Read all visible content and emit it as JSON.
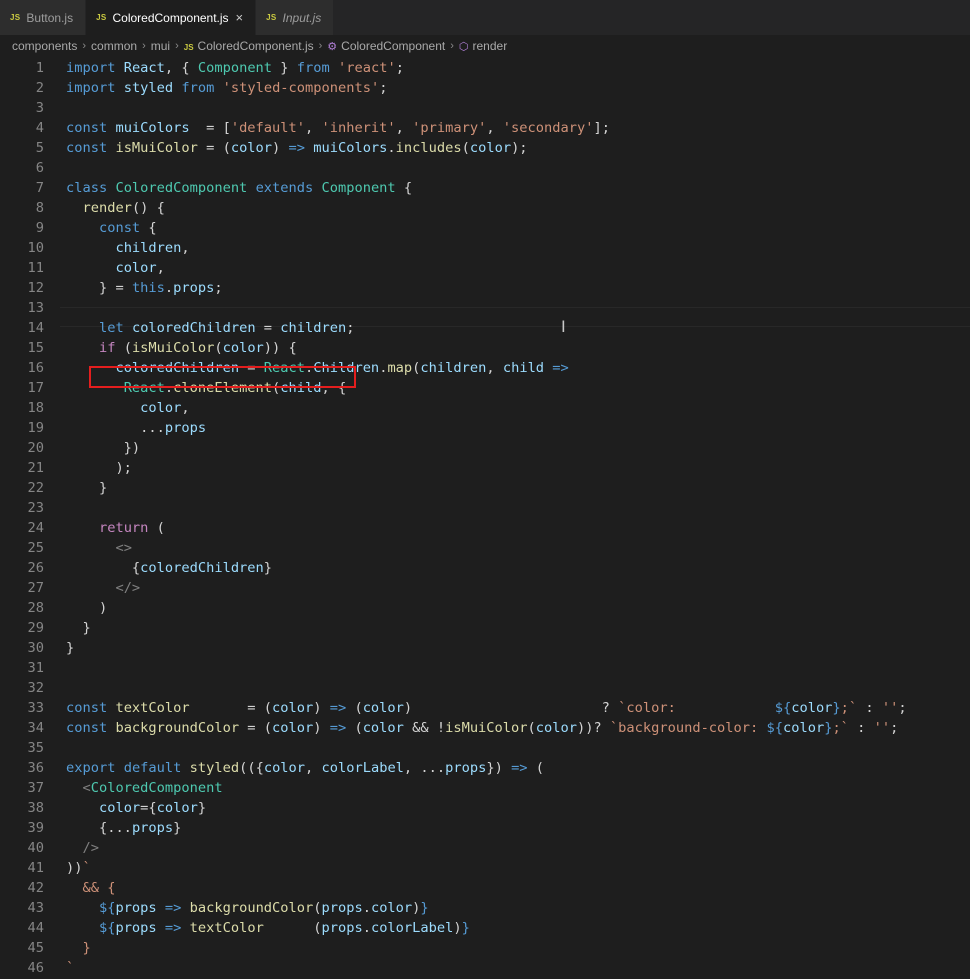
{
  "tabs": [
    {
      "icon": "JS",
      "label": "Button.js"
    },
    {
      "icon": "JS",
      "label": "ColoredComponent.js",
      "close": "×"
    },
    {
      "icon": "JS",
      "label": "Input.js"
    }
  ],
  "breadcrumbs": [
    "components",
    "common",
    "mui",
    "ColoredComponent.js",
    "ColoredComponent",
    "render"
  ],
  "breadcrumb_separator": "›",
  "cursor_glyph": "I",
  "colors": {
    "keyword": "#569cd6",
    "control": "#c586c0",
    "string": "#ce9178",
    "variable": "#9cdcfe",
    "function": "#dcdcaa",
    "class": "#4ec9b0",
    "highlight_box": "#e41e1e"
  },
  "icons": {
    "js_file": "js-icon",
    "close": "close-icon",
    "symbol_class": "class-symbol-icon",
    "symbol_method": "method-symbol-icon",
    "text_cursor": "ibeam-cursor-icon"
  },
  "highlighted_line": 14,
  "code_lines": [
    [
      [
        "kw",
        "import"
      ],
      [
        "pl",
        " "
      ],
      [
        "var",
        "React"
      ],
      [
        "pl",
        ", { "
      ],
      [
        "cls",
        "Component"
      ],
      [
        "pl",
        " } "
      ],
      [
        "kw",
        "from"
      ],
      [
        "pl",
        " "
      ],
      [
        "str",
        "'react'"
      ],
      [
        "pl",
        ";"
      ]
    ],
    [
      [
        "kw",
        "import"
      ],
      [
        "pl",
        " "
      ],
      [
        "var",
        "styled"
      ],
      [
        "pl",
        " "
      ],
      [
        "kw",
        "from"
      ],
      [
        "pl",
        " "
      ],
      [
        "str",
        "'styled-components'"
      ],
      [
        "pl",
        ";"
      ]
    ],
    [],
    [
      [
        "kw",
        "const"
      ],
      [
        "pl",
        " "
      ],
      [
        "var",
        "muiColors"
      ],
      [
        "pl",
        "  = ["
      ],
      [
        "str",
        "'default'"
      ],
      [
        "pl",
        ", "
      ],
      [
        "str",
        "'inherit'"
      ],
      [
        "pl",
        ", "
      ],
      [
        "str",
        "'primary'"
      ],
      [
        "pl",
        ", "
      ],
      [
        "str",
        "'secondary'"
      ],
      [
        "pl",
        "];"
      ]
    ],
    [
      [
        "kw",
        "const"
      ],
      [
        "pl",
        " "
      ],
      [
        "fn",
        "isMuiColor"
      ],
      [
        "pl",
        " = ("
      ],
      [
        "var",
        "color"
      ],
      [
        "pl",
        ") "
      ],
      [
        "kw",
        "=>"
      ],
      [
        "pl",
        " "
      ],
      [
        "var",
        "muiColors"
      ],
      [
        "pl",
        "."
      ],
      [
        "fn",
        "includes"
      ],
      [
        "pl",
        "("
      ],
      [
        "var",
        "color"
      ],
      [
        "pl",
        ");"
      ]
    ],
    [],
    [
      [
        "kw",
        "class"
      ],
      [
        "pl",
        " "
      ],
      [
        "cls",
        "ColoredComponent"
      ],
      [
        "pl",
        " "
      ],
      [
        "kw",
        "extends"
      ],
      [
        "pl",
        " "
      ],
      [
        "cls",
        "Component"
      ],
      [
        "pl",
        " {"
      ]
    ],
    [
      [
        "pl",
        "  "
      ],
      [
        "fn",
        "render"
      ],
      [
        "pl",
        "() {"
      ]
    ],
    [
      [
        "pl",
        "    "
      ],
      [
        "kw",
        "const"
      ],
      [
        "pl",
        " {"
      ]
    ],
    [
      [
        "pl",
        "      "
      ],
      [
        "var",
        "children"
      ],
      [
        "pl",
        ","
      ]
    ],
    [
      [
        "pl",
        "      "
      ],
      [
        "var",
        "color"
      ],
      [
        "pl",
        ","
      ]
    ],
    [
      [
        "pl",
        "    } = "
      ],
      [
        "kw",
        "this"
      ],
      [
        "pl",
        "."
      ],
      [
        "var",
        "props"
      ],
      [
        "pl",
        ";"
      ]
    ],
    [],
    [
      [
        "pl",
        "    "
      ],
      [
        "kw",
        "let"
      ],
      [
        "pl",
        " "
      ],
      [
        "var",
        "coloredChildren"
      ],
      [
        "pl",
        " = "
      ],
      [
        "var",
        "children"
      ],
      [
        "pl",
        ";"
      ]
    ],
    [
      [
        "pl",
        "    "
      ],
      [
        "ctrl",
        "if"
      ],
      [
        "pl",
        " ("
      ],
      [
        "fn",
        "isMuiColor"
      ],
      [
        "pl",
        "("
      ],
      [
        "var",
        "color"
      ],
      [
        "pl",
        ")) {"
      ]
    ],
    [
      [
        "pl",
        "      "
      ],
      [
        "var",
        "coloredChildren"
      ],
      [
        "pl",
        " = "
      ],
      [
        "cls",
        "React"
      ],
      [
        "pl",
        "."
      ],
      [
        "var",
        "Children"
      ],
      [
        "pl",
        "."
      ],
      [
        "fn",
        "map"
      ],
      [
        "pl",
        "("
      ],
      [
        "var",
        "children"
      ],
      [
        "pl",
        ", "
      ],
      [
        "var",
        "child"
      ],
      [
        "pl",
        " "
      ],
      [
        "kw",
        "=>"
      ]
    ],
    [
      [
        "pl",
        "       "
      ],
      [
        "cls",
        "React"
      ],
      [
        "pl",
        "."
      ],
      [
        "fn",
        "cloneElement"
      ],
      [
        "pl",
        "("
      ],
      [
        "var",
        "child"
      ],
      [
        "pl",
        ", {"
      ]
    ],
    [
      [
        "pl",
        "         "
      ],
      [
        "var",
        "color"
      ],
      [
        "pl",
        ","
      ]
    ],
    [
      [
        "pl",
        "         ..."
      ],
      [
        "var",
        "props"
      ]
    ],
    [
      [
        "pl",
        "       })"
      ]
    ],
    [
      [
        "pl",
        "      );"
      ]
    ],
    [
      [
        "pl",
        "    }"
      ]
    ],
    [],
    [
      [
        "pl",
        "    "
      ],
      [
        "ctrl",
        "return"
      ],
      [
        "pl",
        " ("
      ]
    ],
    [
      [
        "pl",
        "      "
      ],
      [
        "tag",
        "<>"
      ]
    ],
    [
      [
        "pl",
        "        {"
      ],
      [
        "var",
        "coloredChildren"
      ],
      [
        "pl",
        "}"
      ]
    ],
    [
      [
        "pl",
        "      "
      ],
      [
        "tag",
        "</>"
      ]
    ],
    [
      [
        "pl",
        "    )"
      ]
    ],
    [
      [
        "pl",
        "  }"
      ]
    ],
    [
      [
        "pl",
        "}"
      ]
    ],
    [],
    [],
    [
      [
        "kw",
        "const"
      ],
      [
        "pl",
        " "
      ],
      [
        "fn",
        "textColor"
      ],
      [
        "pl",
        "       = ("
      ],
      [
        "var",
        "color"
      ],
      [
        "pl",
        ") "
      ],
      [
        "kw",
        "=>"
      ],
      [
        "pl",
        " ("
      ],
      [
        "var",
        "color"
      ],
      [
        "pl",
        ")                       ? "
      ],
      [
        "str",
        "`color:            "
      ],
      [
        "kw",
        "${"
      ],
      [
        "var",
        "color"
      ],
      [
        "kw",
        "}"
      ],
      [
        "str",
        ";`"
      ],
      [
        "pl",
        " : "
      ],
      [
        "str",
        "''"
      ],
      [
        "pl",
        ";"
      ]
    ],
    [
      [
        "kw",
        "const"
      ],
      [
        "pl",
        " "
      ],
      [
        "fn",
        "backgroundColor"
      ],
      [
        "pl",
        " = ("
      ],
      [
        "var",
        "color"
      ],
      [
        "pl",
        ") "
      ],
      [
        "kw",
        "=>"
      ],
      [
        "pl",
        " ("
      ],
      [
        "var",
        "color"
      ],
      [
        "pl",
        " && !"
      ],
      [
        "fn",
        "isMuiColor"
      ],
      [
        "pl",
        "("
      ],
      [
        "var",
        "color"
      ],
      [
        "pl",
        "))? "
      ],
      [
        "str",
        "`background-color: "
      ],
      [
        "kw",
        "${"
      ],
      [
        "var",
        "color"
      ],
      [
        "kw",
        "}"
      ],
      [
        "str",
        ";`"
      ],
      [
        "pl",
        " : "
      ],
      [
        "str",
        "''"
      ],
      [
        "pl",
        ";"
      ]
    ],
    [],
    [
      [
        "kw",
        "export"
      ],
      [
        "pl",
        " "
      ],
      [
        "kw",
        "default"
      ],
      [
        "pl",
        " "
      ],
      [
        "fn",
        "styled"
      ],
      [
        "pl",
        "(({"
      ],
      [
        "var",
        "color"
      ],
      [
        "pl",
        ", "
      ],
      [
        "var",
        "colorLabel"
      ],
      [
        "pl",
        ", ..."
      ],
      [
        "var",
        "props"
      ],
      [
        "pl",
        "}) "
      ],
      [
        "kw",
        "=>"
      ],
      [
        "pl",
        " ("
      ]
    ],
    [
      [
        "pl",
        "  "
      ],
      [
        "tag",
        "<"
      ],
      [
        "tagn",
        "ColoredComponent"
      ]
    ],
    [
      [
        "pl",
        "    "
      ],
      [
        "var",
        "color"
      ],
      [
        "pl",
        "={"
      ],
      [
        "var",
        "color"
      ],
      [
        "pl",
        "}"
      ]
    ],
    [
      [
        "pl",
        "    {..."
      ],
      [
        "var",
        "props"
      ],
      [
        "pl",
        "}"
      ]
    ],
    [
      [
        "pl",
        "  "
      ],
      [
        "tag",
        "/>"
      ]
    ],
    [
      [
        "pl",
        "))"
      ],
      [
        "str",
        "`"
      ]
    ],
    [
      [
        "str",
        "  && {"
      ]
    ],
    [
      [
        "str",
        "    "
      ],
      [
        "kw",
        "${"
      ],
      [
        "var",
        "props"
      ],
      [
        "pl",
        " "
      ],
      [
        "kw",
        "=>"
      ],
      [
        "pl",
        " "
      ],
      [
        "fn",
        "backgroundColor"
      ],
      [
        "pl",
        "("
      ],
      [
        "var",
        "props"
      ],
      [
        "pl",
        "."
      ],
      [
        "var",
        "color"
      ],
      [
        "pl",
        ")"
      ],
      [
        "kw",
        "}"
      ]
    ],
    [
      [
        "str",
        "    "
      ],
      [
        "kw",
        "${"
      ],
      [
        "var",
        "props"
      ],
      [
        "pl",
        " "
      ],
      [
        "kw",
        "=>"
      ],
      [
        "pl",
        " "
      ],
      [
        "fn",
        "textColor"
      ],
      [
        "pl",
        "      ("
      ],
      [
        "var",
        "props"
      ],
      [
        "pl",
        "."
      ],
      [
        "var",
        "colorLabel"
      ],
      [
        "pl",
        ")"
      ],
      [
        "kw",
        "}"
      ]
    ],
    [
      [
        "str",
        "  }"
      ]
    ],
    [
      [
        "str",
        "`"
      ]
    ]
  ]
}
